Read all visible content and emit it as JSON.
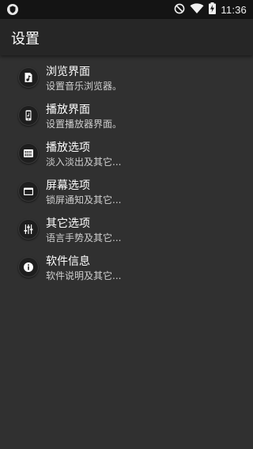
{
  "status_bar": {
    "time": "11:36",
    "left_icon": "shield-icon",
    "right_icons": [
      "do-not-disturb-icon",
      "wifi-icon",
      "battery-charging-icon"
    ]
  },
  "toolbar": {
    "title": "设置"
  },
  "settings_items": [
    {
      "icon": "music-file-icon",
      "title": "浏览界面",
      "subtitle": "设置音乐浏览器。"
    },
    {
      "icon": "phone-player-icon",
      "title": "播放界面",
      "subtitle": "设置播放器界面。"
    },
    {
      "icon": "equalizer-icon",
      "title": "播放选项",
      "subtitle": "淡入淡出及其它..."
    },
    {
      "icon": "window-icon",
      "title": "屏幕选项",
      "subtitle": "锁屏通知及其它..."
    },
    {
      "icon": "sliders-icon",
      "title": "其它选项",
      "subtitle": "语言手势及其它..."
    },
    {
      "icon": "info-icon",
      "title": "软件信息",
      "subtitle": "软件说明及其它..."
    }
  ]
}
